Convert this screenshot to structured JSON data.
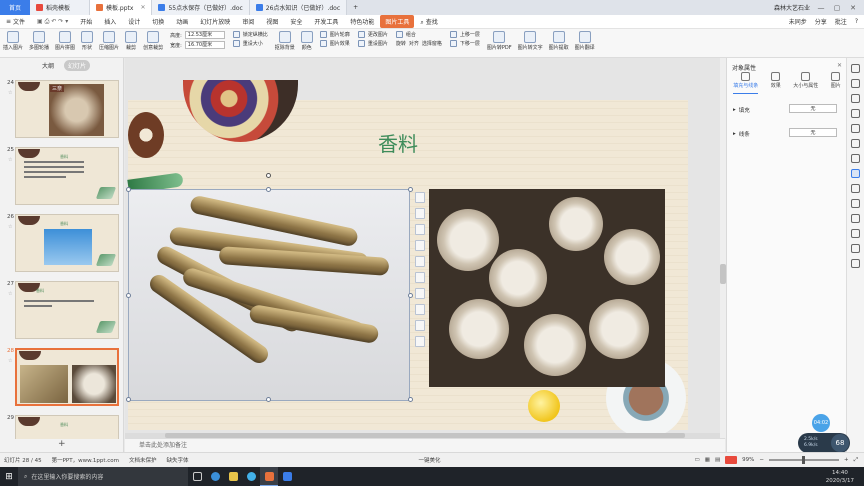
{
  "titlebar": {
    "home": "首页",
    "tabs": [
      {
        "label": "稻壳模板",
        "color": "#e8493c"
      },
      {
        "label": "模板.pptx",
        "color": "#e8713c",
        "active": true
      },
      {
        "label": "55点水保存（已做好）.doc",
        "color": "#3b7de9"
      },
      {
        "label": "26点水知识（已做好）.doc",
        "color": "#3b7de9"
      }
    ],
    "new_tab": "+",
    "right_user": "森林大艺石业"
  },
  "menubar": {
    "file": "文件",
    "items": [
      "开始",
      "插入",
      "设计",
      "切换",
      "动画",
      "幻灯片放映",
      "审阅",
      "视图",
      "安全",
      "开发工具",
      "特色功能"
    ],
    "active_tool": "图片工具",
    "search": "查找",
    "right": [
      "未同步",
      "分享",
      "批注",
      "?"
    ]
  },
  "ribbon": {
    "left_buttons": [
      "插入图片",
      "多图轮播",
      "图片拼图",
      "形状"
    ],
    "compress": "压缩图片",
    "crop": "裁剪",
    "creative_crop": "创意裁剪",
    "height_label": "高度:",
    "height_value": "12.53厘米",
    "width_label": "宽度:",
    "width_value": "16.70厘米",
    "lock_ratio": "锁定纵横比",
    "reset_size": "重设大小",
    "matting": "抠除背景",
    "color": "颜色",
    "outline": "图片轮廓",
    "change_pic": "更改图片",
    "effects": "图片效果",
    "reset_pic": "重设图片",
    "combine": "组合",
    "rotate": "旋转",
    "align": "对齐",
    "select_pane": "选择窗格",
    "up_layer": "上移一层",
    "down_layer": "下移一层",
    "to_pdf": "图片转PDF",
    "to_text": "图片转文字",
    "extract": "图片提取",
    "translate": "图片翻译"
  },
  "leftpanel": {
    "tab_outline": "大纲",
    "tab_slides": "幻灯片",
    "slides": [
      {
        "num": "24",
        "title": "三奈"
      },
      {
        "num": "25",
        "title": "香料"
      },
      {
        "num": "26",
        "title": "香料"
      },
      {
        "num": "27",
        "title": "香料"
      },
      {
        "num": "28",
        "title": ""
      },
      {
        "num": "29",
        "title": "香料"
      }
    ],
    "add": "+"
  },
  "slide": {
    "title": "香料"
  },
  "notes": {
    "placeholder": "单击此处添加备注"
  },
  "rightpanel": {
    "title": "对象属性",
    "tabs": [
      "填充与线条",
      "效果",
      "大小与属性",
      "图片"
    ],
    "fill_label": "填充",
    "fill_value": "无",
    "line_label": "线条",
    "line_value": "无"
  },
  "statusbar": {
    "slide_info": "幻灯片 28 / 45",
    "theme": "第一PPT，www.1ppt.com",
    "protect": "文档未保护",
    "font_missing": "缺失字体",
    "beautify": "一键美化",
    "zoom": "99%"
  },
  "taskbar": {
    "search_placeholder": "在这里输入你要搜索的内容",
    "time": "14:40",
    "date": "2020/3/17"
  },
  "widgets": {
    "timer": "04:02",
    "net_up": "2.5k/s",
    "net_down": "6.9k/s",
    "percent": "68"
  }
}
